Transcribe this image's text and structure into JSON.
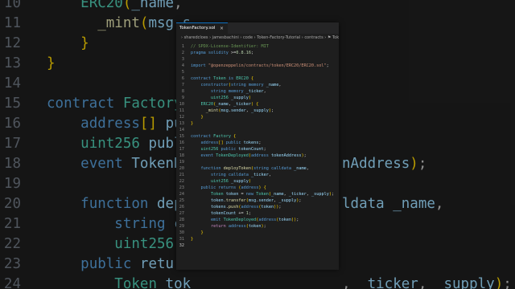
{
  "background_editor": {
    "lines": [
      {
        "num": "10",
        "code": "    ERC20(_name, "
      },
      {
        "num": "11",
        "code": "      _mint(msg.s"
      },
      {
        "num": "12",
        "code": "    }"
      },
      {
        "num": "13",
        "code": "}"
      },
      {
        "num": "14",
        "code": ""
      },
      {
        "num": "15",
        "code": "contract Factory"
      },
      {
        "num": "16",
        "code": "    address[] pub"
      },
      {
        "num": "17",
        "code": "    uint256 publ"
      },
      {
        "num": "18",
        "code": "    event TokenDe"
      },
      {
        "num": "19",
        "code": ""
      },
      {
        "num": "20",
        "code": "    function depl"
      },
      {
        "num": "21",
        "code": "        string c"
      },
      {
        "num": "22",
        "code": "        uint256 _"
      },
      {
        "num": "23",
        "code": "    public retur"
      },
      {
        "num": "24",
        "code": "        Token tok"
      }
    ],
    "right_fragments": {
      "line18": "nAddress);",
      "line20": "ldata _name,",
      "line24": ", _ticker, _supply);"
    }
  },
  "editor": {
    "tab_label": "TokenFactory.sol",
    "tab_close": "×",
    "breadcrumbs": "› sharedcloes › jamesbachini › code › Token-Factory-Tutorial › contracts › ⚑ Toke",
    "lines": [
      {
        "num": "1",
        "code": "// SPDX-License-Identifier: MIT"
      },
      {
        "num": "2",
        "code": "pragma solidity >=0.8.16;"
      },
      {
        "num": "3",
        "code": ""
      },
      {
        "num": "4",
        "code": "import \"@openzeppelin/contracts/token/ERC20/ERC20.sol\";"
      },
      {
        "num": "5",
        "code": ""
      },
      {
        "num": "6",
        "code": "contract Token is ERC20 {"
      },
      {
        "num": "7",
        "code": "    constructor(string memory _name,"
      },
      {
        "num": "8",
        "code": "        string memory _ticker,"
      },
      {
        "num": "9",
        "code": "        uint256 _supply)"
      },
      {
        "num": "10",
        "code": "    ERC20(_name, _ticker) {"
      },
      {
        "num": "11",
        "code": "      _mint(msg.sender, _supply);"
      },
      {
        "num": "12",
        "code": "    }"
      },
      {
        "num": "13",
        "code": "}"
      },
      {
        "num": "14",
        "code": ""
      },
      {
        "num": "15",
        "code": "contract Factory {"
      },
      {
        "num": "16",
        "code": "    address[] public tokens;"
      },
      {
        "num": "17",
        "code": "    uint256 public tokenCount;"
      },
      {
        "num": "18",
        "code": "    event TokenDeployed(address tokenAddress);"
      },
      {
        "num": "19",
        "code": ""
      },
      {
        "num": "20",
        "code": "    function deployToken(string calldata _name,"
      },
      {
        "num": "21",
        "code": "        string calldata _ticker,"
      },
      {
        "num": "22",
        "code": "        uint256 _supply)"
      },
      {
        "num": "23",
        "code": "    public returns (address) {"
      },
      {
        "num": "24",
        "code": "        Token token = new Token(_name, _ticker, _supply);"
      },
      {
        "num": "25",
        "code": "        token.transfer(msg.sender, _supply);"
      },
      {
        "num": "26",
        "code": "        tokens.push(address(token));"
      },
      {
        "num": "27",
        "code": "        tokenCount += 1;"
      },
      {
        "num": "28",
        "code": "        emit TokenDeployed(address(token));"
      },
      {
        "num": "29",
        "code": "        return address(token);"
      },
      {
        "num": "30",
        "code": "    }"
      },
      {
        "num": "31",
        "code": "}"
      },
      {
        "num": "32",
        "code": ""
      }
    ]
  },
  "colors": {
    "editor_bg": "#1e1e1e",
    "keyword": "#569cd6",
    "control": "#c586c0",
    "type": "#4ec9b0",
    "function": "#dcdcaa",
    "variable": "#9cdcfe",
    "string": "#ce9178",
    "number": "#b5cea8",
    "comment": "#6a9955",
    "tab_accent": "#0e70c0"
  }
}
